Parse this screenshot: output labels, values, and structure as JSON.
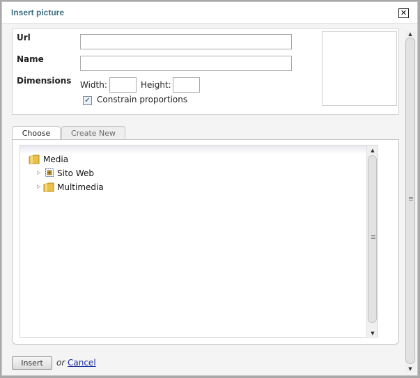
{
  "dialog": {
    "title": "Insert picture",
    "close_glyph": "✕"
  },
  "form": {
    "url_label": "Url",
    "url_value": "",
    "name_label": "Name",
    "name_value": "",
    "dimensions_label": "Dimensions",
    "width_label": "Width:",
    "width_value": "",
    "height_label": "Height:",
    "height_value": "",
    "constrain_label": "Constrain proportions",
    "constrain_checked": true
  },
  "tabs": [
    {
      "label": "Choose",
      "active": true
    },
    {
      "label": "Create New",
      "active": false
    }
  ],
  "tree": {
    "root": {
      "label": "Media",
      "icon": "folder-icon"
    },
    "children": [
      {
        "label": "Sito Web",
        "icon": "site-icon",
        "expander": "collapsed"
      },
      {
        "label": "Multimedia",
        "icon": "folder-icon",
        "expander": "collapsed"
      }
    ]
  },
  "footer": {
    "insert_label": "Insert",
    "or_text": "or",
    "cancel_label": "Cancel"
  },
  "colors": {
    "title": "#3d7080",
    "link": "#1b2fa6",
    "folder": "#e8c04a"
  }
}
